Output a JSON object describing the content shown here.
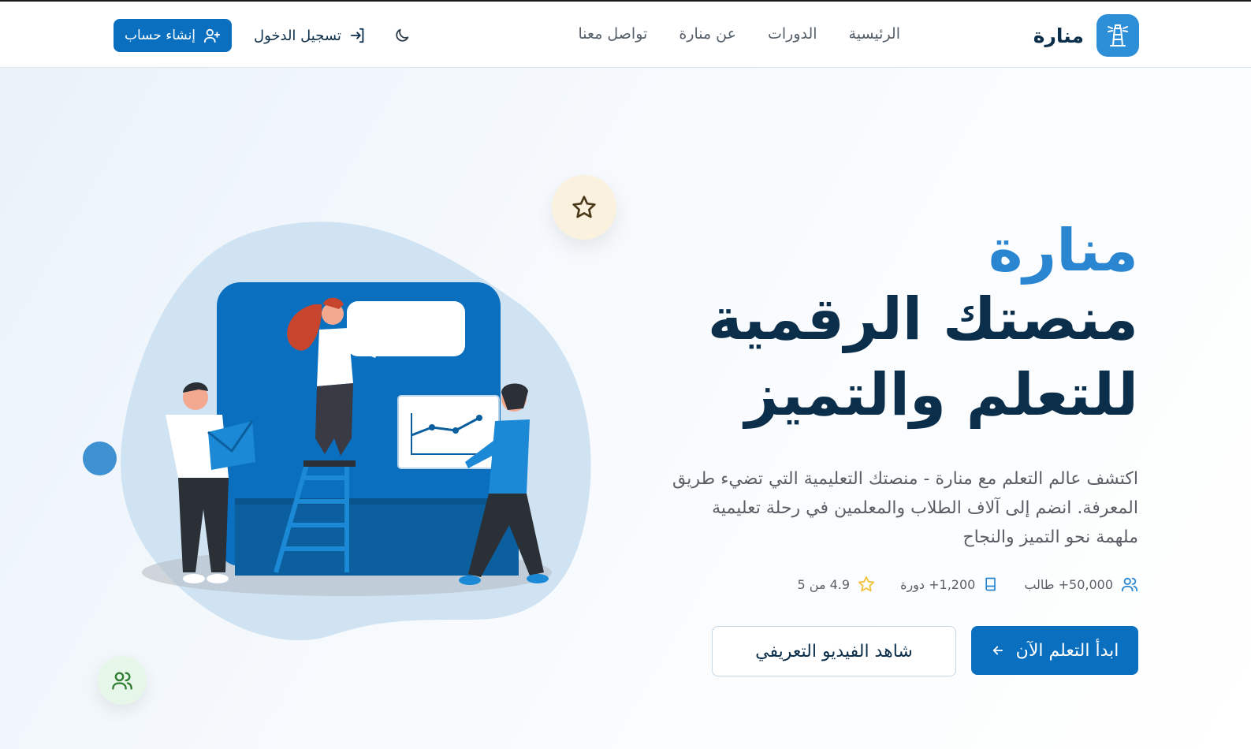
{
  "brand": {
    "name": "منارة",
    "logo_icon": "lighthouse-icon"
  },
  "nav": {
    "items": [
      "الرئيسية",
      "الدورات",
      "عن منارة",
      "تواصل معنا"
    ]
  },
  "header_actions": {
    "theme_icon": "moon-icon",
    "login_label": "تسجيل الدخول",
    "signup_label": "إنشاء حساب"
  },
  "hero": {
    "title_line1": "منارة",
    "title_line2": "منصتك الرقمية",
    "title_line3": "للتعلم والتميز",
    "description": "اكتشف عالم التعلم مع منارة - منصتك التعليمية التي تضيء طريق المعرفة. انضم إلى آلاف الطلاب والمعلمين في رحلة تعليمية ملهمة نحو التميز والنجاح",
    "stats": {
      "students": "50,000+ طالب",
      "courses": "1,200+ دورة",
      "rating": "4.9 من 5"
    },
    "cta_primary": "ابدأ التعلم الآن",
    "cta_secondary": "شاهد الفيديو التعريفي"
  },
  "colors": {
    "primary": "#0a6fbf",
    "accent": "#2a86d1",
    "heading": "#0b2e4a",
    "star": "#f2c23a"
  }
}
